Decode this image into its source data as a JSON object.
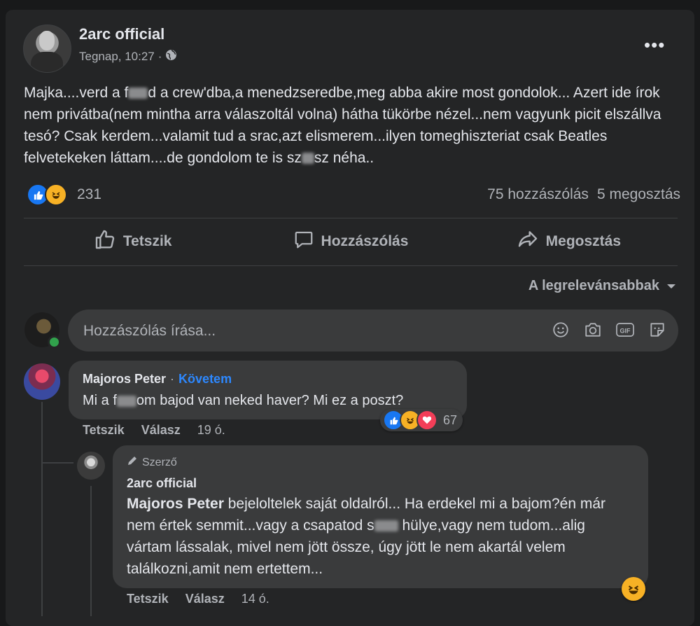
{
  "post": {
    "author": "2arc official",
    "time": "Tegnap, 10:27",
    "audience_icon": "globe-icon",
    "more_label": "•••",
    "text_parts": [
      "Majka....verd a f",
      "d a crew'dba,a menedzseredbe,meg abba akire most gondolok... Azert ide írok nem privátba(nem mintha arra válaszoltál volna) hátha tükörbe nézel...nem vagyunk picit elszállva tesó? Csak kerdem...valamit tud a srac,azt elismerem...ilyen tomeghiszteriat csak Beatles felvetekeken láttam....de gondolom te is sz",
      "sz néha.."
    ],
    "reaction_icons": [
      "like-icon",
      "haha-icon"
    ],
    "reaction_count": "231",
    "comments_count": "75 hozzászólás",
    "shares_count": "5 megosztás"
  },
  "actions": {
    "like": "Tetszik",
    "comment": "Hozzászólás",
    "share": "Megosztás"
  },
  "sort_label": "A legrelevánsabbak",
  "comment_input": {
    "placeholder": "Hozzászólás írása...",
    "icons": [
      "emoji-icon",
      "camera-icon",
      "gif-icon",
      "sticker-icon"
    ]
  },
  "comment1": {
    "name": "Majoros Peter",
    "separator": "·",
    "follow": "Követem",
    "text_parts": [
      "Mi a f",
      "om bajod van neked haver? Mi ez a poszt?"
    ],
    "like": "Tetszik",
    "reply": "Válasz",
    "time": "19 ó.",
    "reaction_icons": [
      "like-icon",
      "haha-icon",
      "love-icon"
    ],
    "reaction_count": "67"
  },
  "reply1": {
    "badge": "Szerző",
    "name": "2arc official",
    "mention": "Majoros Peter",
    "text_parts": [
      " bejeloltelek saját oldalról... Ha erdekel mi a bajom?én már nem értek semmit...vagy a csapatod s",
      " hülye,vagy nem tudom...alig vártam lássalak, mivel nem jött össze, úgy jött le nem akartál velem találkozni,amit nem ertettem..."
    ],
    "like": "Tetszik",
    "reply": "Válasz",
    "time": "14 ó.",
    "reaction_icon": "haha-icon"
  },
  "colors": {
    "background": "#18191a",
    "card": "#242526",
    "bubble": "#3a3b3c",
    "link": "#2d88ff",
    "like_blue": "#1877f2",
    "haha_yellow": "#f7b125",
    "love_red": "#f33e58"
  }
}
